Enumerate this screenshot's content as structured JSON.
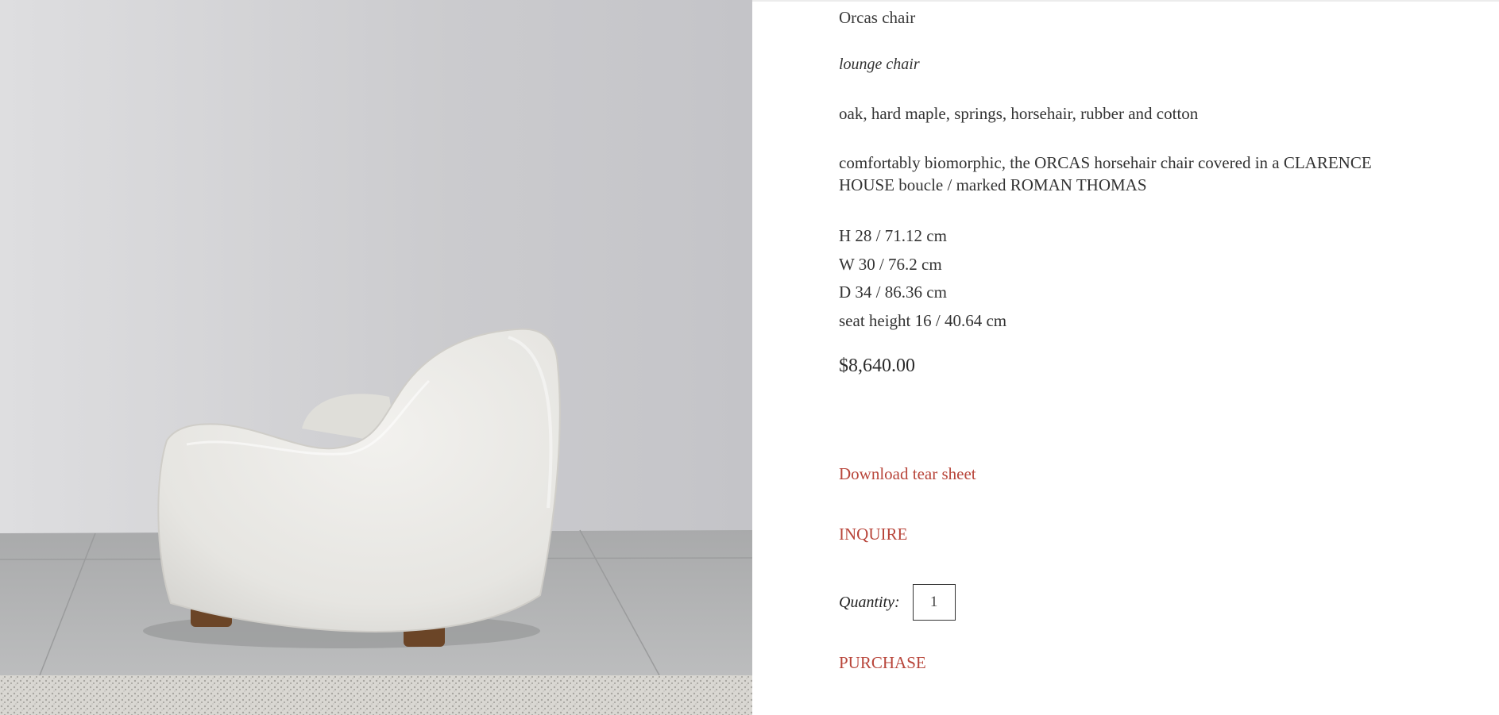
{
  "product": {
    "title": "Orcas chair",
    "type": "lounge chair",
    "materials": "oak, hard maple, springs, horsehair, rubber and cotton",
    "description": "comfortably biomorphic, the ORCAS horsehair chair covered in a CLARENCE HOUSE boucle / marked ROMAN THOMAS",
    "dimensions": [
      "H 28 / 71.12 cm",
      "W 30 / 76.2 cm",
      "D 34 / 86.36 cm",
      "seat height 16 / 40.64 cm"
    ],
    "price": "$8,640.00"
  },
  "actions": {
    "download_label": "Download tear sheet",
    "inquire_label": "INQUIRE",
    "quantity_label": "Quantity:",
    "quantity_value": "1",
    "purchase_label": "PURCHASE"
  },
  "colors": {
    "accent": "#b8453a",
    "text": "#333333"
  }
}
